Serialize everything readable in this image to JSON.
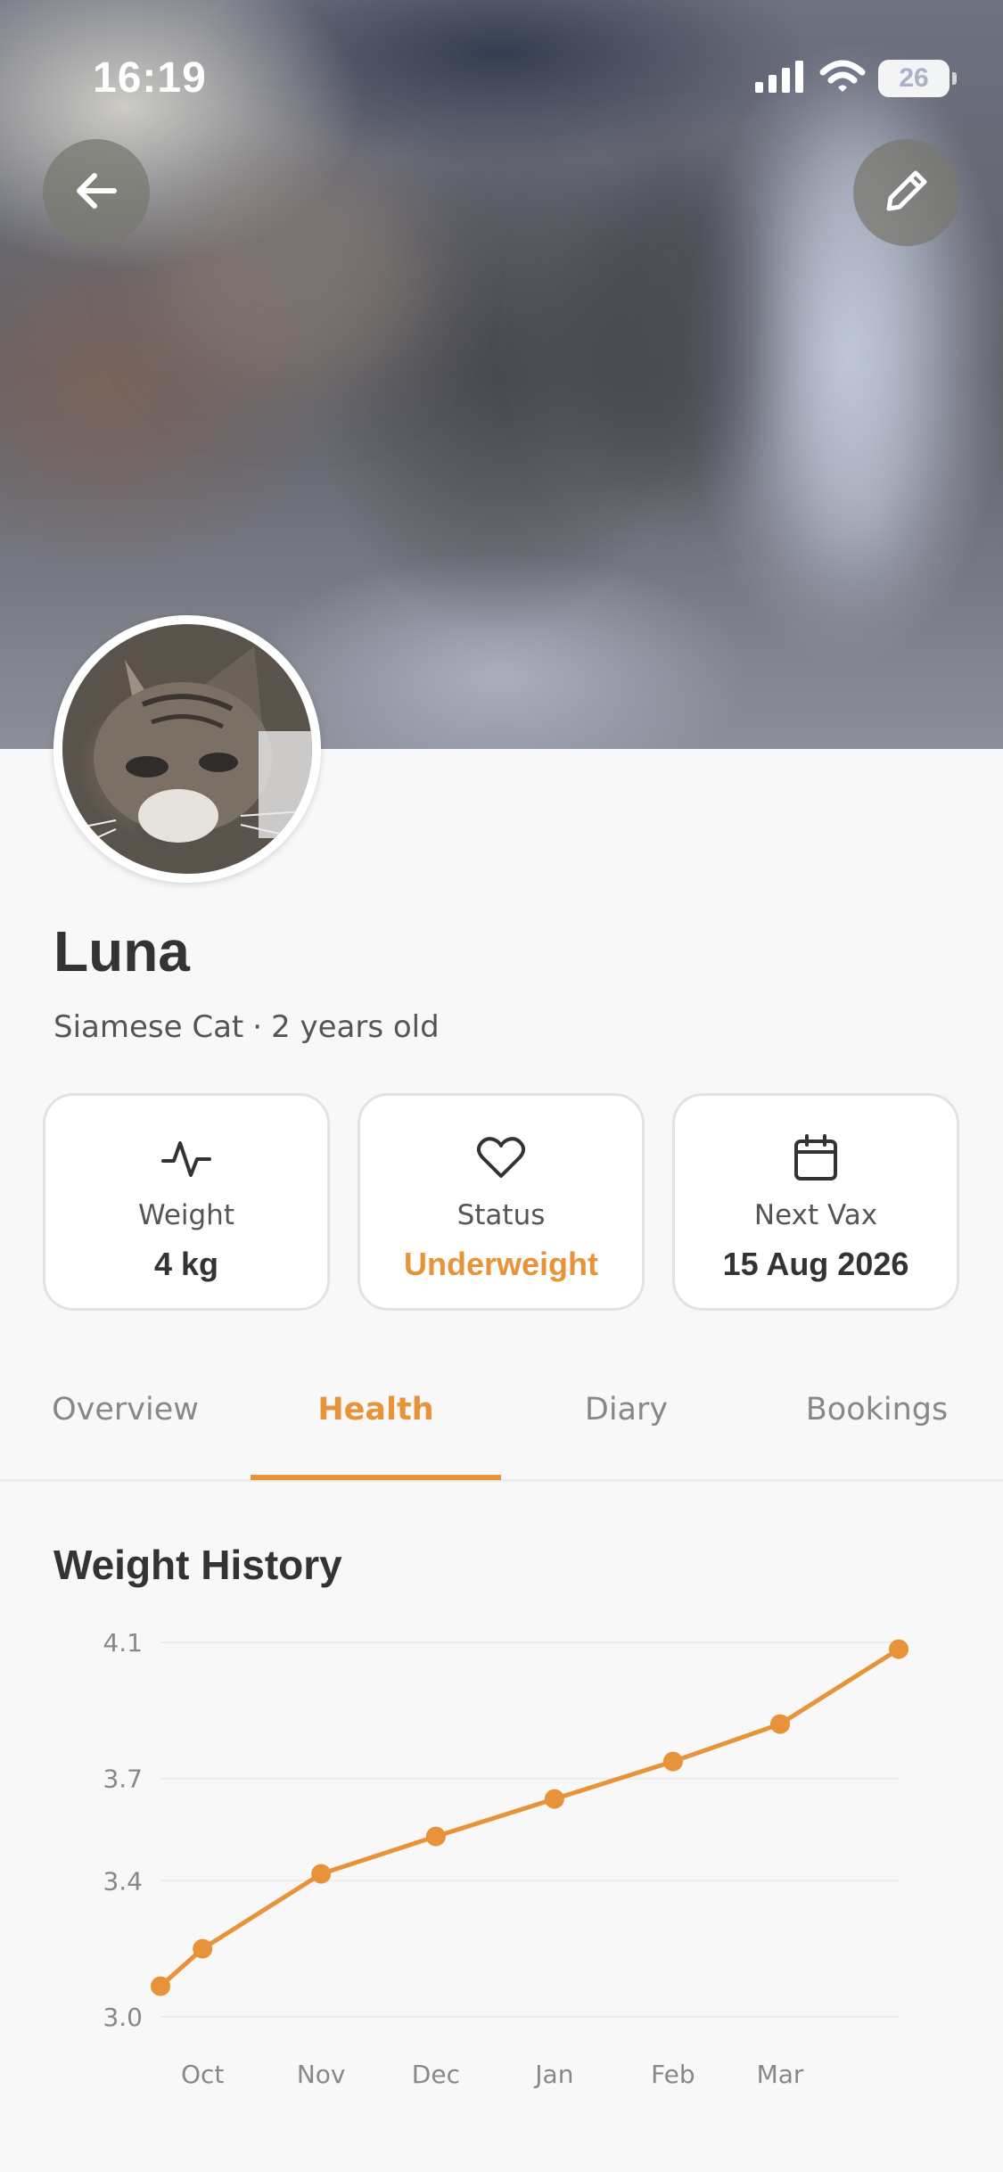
{
  "status_bar": {
    "time": "16:19",
    "battery": "26",
    "icons": [
      "signal-icon",
      "wifi-icon",
      "battery-icon"
    ]
  },
  "header": {
    "back_icon": "arrow-left-icon",
    "edit_icon": "pencil-icon"
  },
  "pet": {
    "name": "Luna",
    "breed": "Siamese Cat",
    "separator": "·",
    "age": "2 years old"
  },
  "stats": [
    {
      "icon": "activity-icon",
      "label": "Weight",
      "value": "4 kg"
    },
    {
      "icon": "heart-icon",
      "label": "Status",
      "value": "Underweight"
    },
    {
      "icon": "calendar-icon",
      "label": "Next Vax",
      "value": "15 Aug 2026"
    }
  ],
  "tabs": [
    {
      "label": "Overview",
      "active": false
    },
    {
      "label": "Health",
      "active": true
    },
    {
      "label": "Diary",
      "active": false
    },
    {
      "label": "Bookings",
      "active": false
    }
  ],
  "colors": {
    "accent": "#e8923a",
    "text": "#333333",
    "muted": "#888888"
  },
  "weight_history": {
    "title": "Weight History"
  },
  "chart_data": {
    "type": "line",
    "title": "Weight History",
    "xlabel": "",
    "ylabel": "",
    "ylim": [
      3.0,
      4.1
    ],
    "yticks": [
      "4.1",
      "3.7",
      "3.4",
      "3.0"
    ],
    "xticks": [
      "Oct",
      "Nov",
      "Dec",
      "Jan",
      "Feb",
      "Mar"
    ],
    "grid": true,
    "series": [
      {
        "x": [
          "2025-09-20",
          "2025-10-01",
          "2025-11-01",
          "2025-12-01",
          "2026-01-01",
          "2026-02-01",
          "2026-03-01",
          "2026-04-01"
        ],
        "values": [
          3.09,
          3.2,
          3.42,
          3.53,
          3.64,
          3.75,
          3.86,
          4.08
        ]
      }
    ]
  }
}
